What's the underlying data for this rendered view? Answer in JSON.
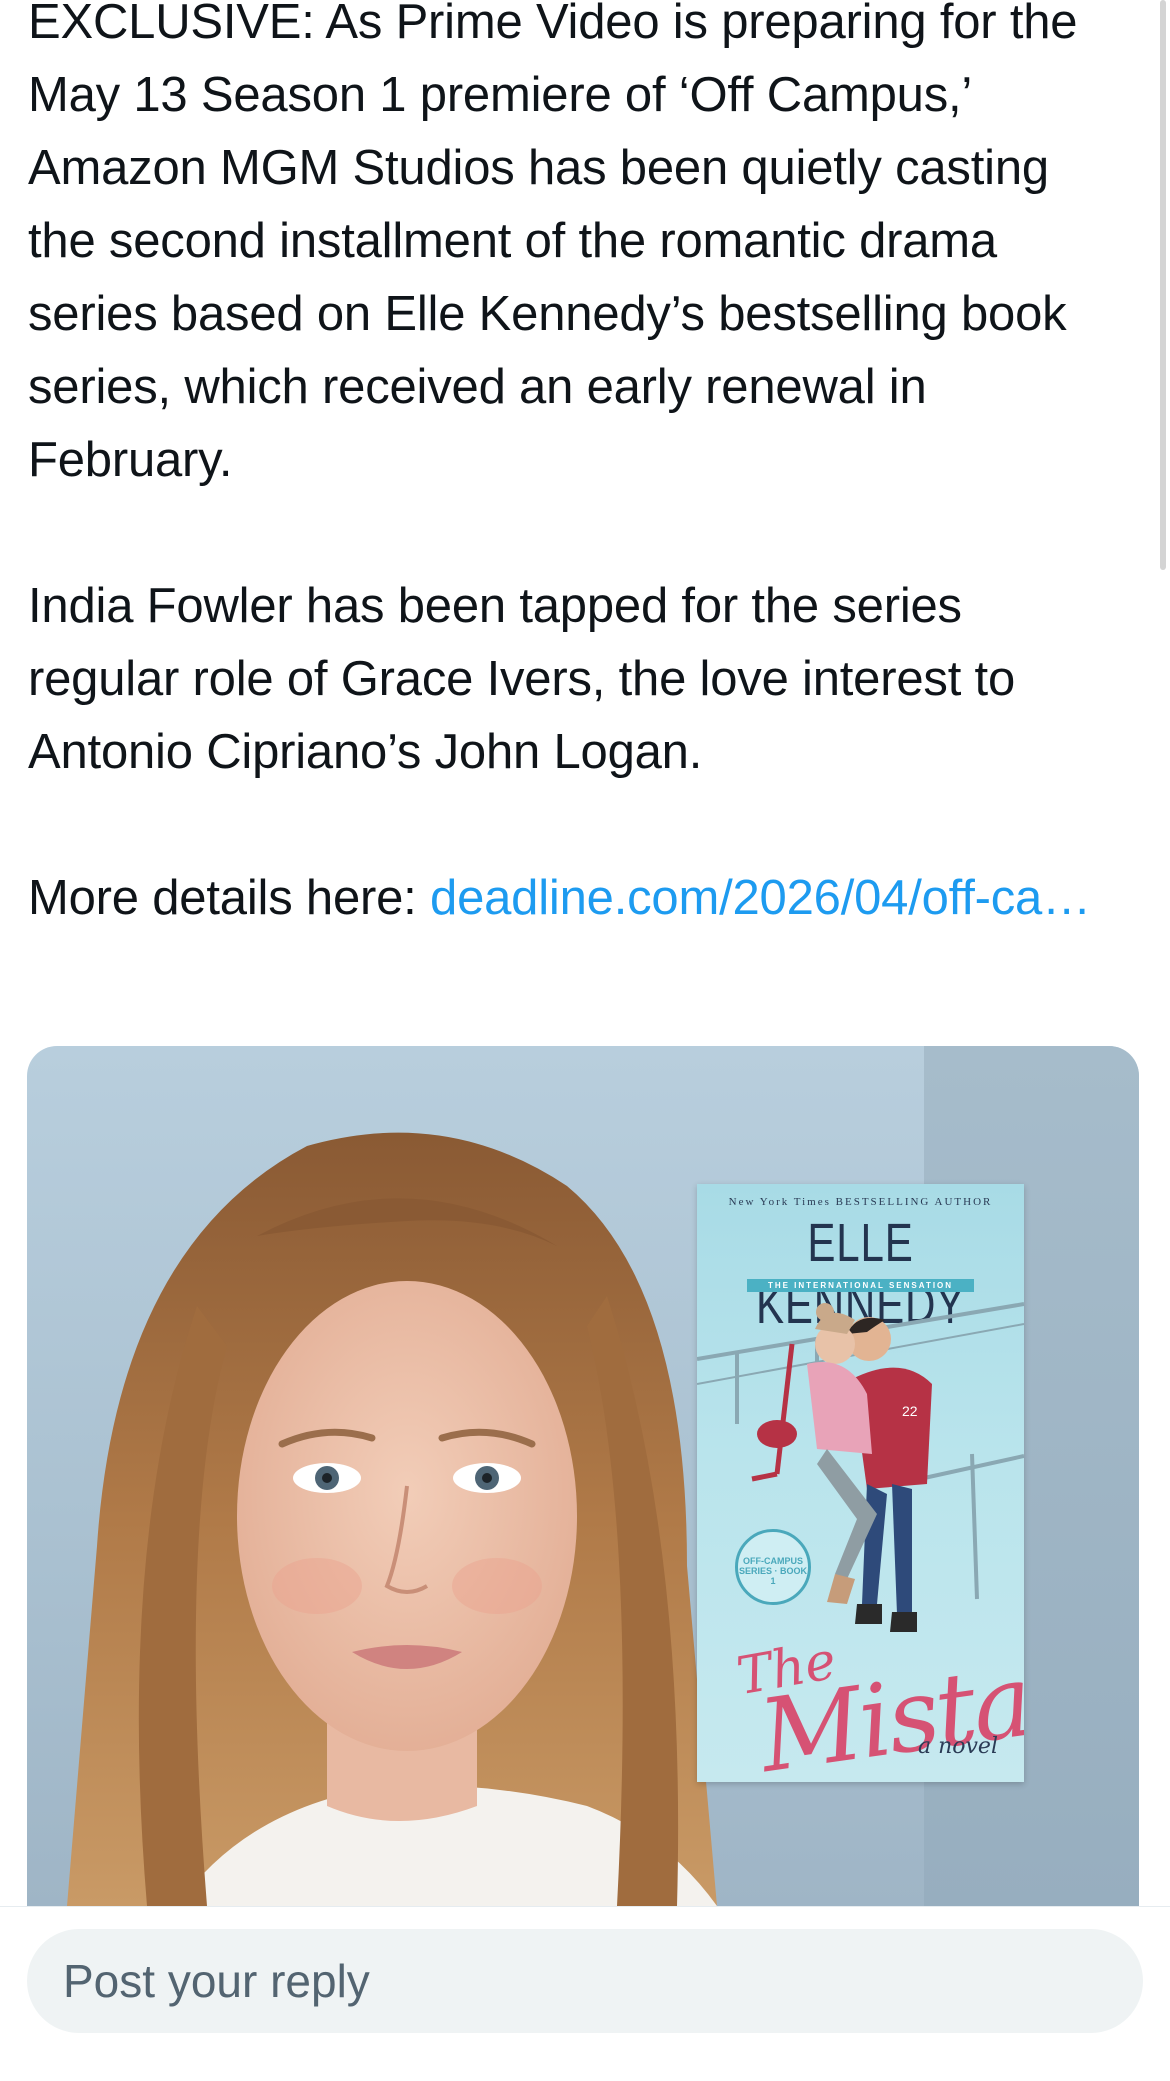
{
  "tweet": {
    "paragraph1": "EXCLUSIVE: As Prime Video is preparing for the May 13 Season 1 premiere of ‘Off Campus,’ Amazon MGM Studios has been quietly casting the second installment of the romantic drama series based on Elle Kennedy’s bestselling book series, which received an early renewal in February.",
    "paragraph2": "India Fowler has been tapped for the series regular role of Grace Ivers, the love interest to Antonio Cipriano’s John Logan.",
    "paragraph3_prefix": "More details here: ",
    "link_text": "deadline.com/2026/04/off-ca…"
  },
  "book_cover": {
    "nyt_line": "New York Times BESTSELLING AUTHOR",
    "author": "ELLE KENNEDY",
    "tagline": "THE INTERNATIONAL SENSATION",
    "seal": "OFF-CAMPUS SERIES · BOOK 1",
    "title_the": "The",
    "title_main": "Mistake",
    "subtitle": "a novel",
    "jersey_number": "22"
  },
  "reply": {
    "placeholder": "Post your reply"
  },
  "colors": {
    "link": "#1d9bf0",
    "text": "#0f1419",
    "reply_bg": "#eff3f4",
    "placeholder": "#536471"
  }
}
